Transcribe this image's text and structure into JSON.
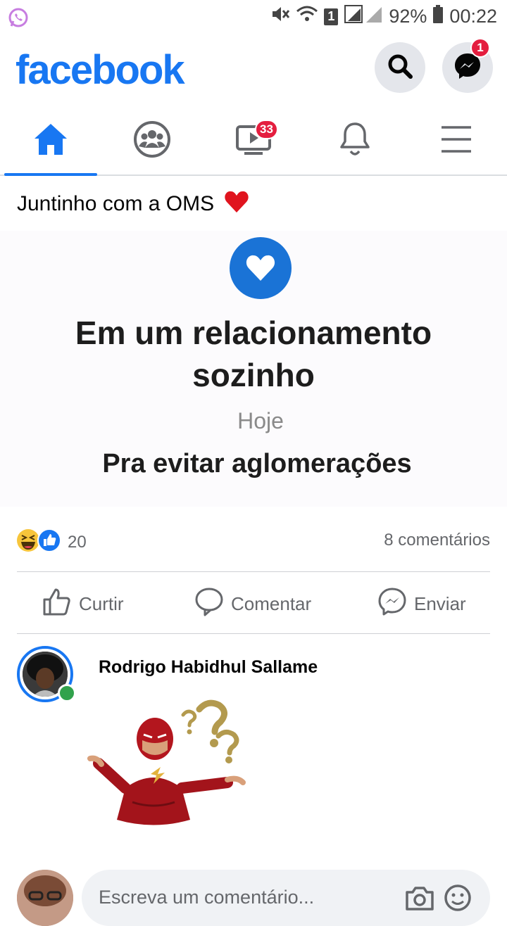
{
  "status_bar": {
    "battery": "92%",
    "time": "00:22",
    "sim_badge": "1"
  },
  "header": {
    "logo": "facebook",
    "messenger_badge": "1"
  },
  "tabs": [
    {
      "name": "home",
      "active": true
    },
    {
      "name": "groups",
      "active": false
    },
    {
      "name": "watch",
      "active": false,
      "badge": "33"
    },
    {
      "name": "notifications",
      "active": false
    },
    {
      "name": "menu",
      "active": false
    }
  ],
  "post": {
    "text": "Juntinho com a OMS",
    "image": {
      "line1": "Em um relacionamento",
      "line2": "sozinho",
      "line3": "Hoje",
      "line4": "Pra evitar aglomerações"
    },
    "reaction_count": "20",
    "comments": "8 comentários",
    "actions": {
      "like": "Curtir",
      "comment": "Comentar",
      "send": "Enviar"
    }
  },
  "comment": {
    "author": "Rodrigo Habidhul Sallame"
  },
  "composer": {
    "placeholder": "Escreva um comentário..."
  },
  "colors": {
    "brand": "#1877f2",
    "badge": "#e41e3f",
    "online": "#31a24c"
  }
}
